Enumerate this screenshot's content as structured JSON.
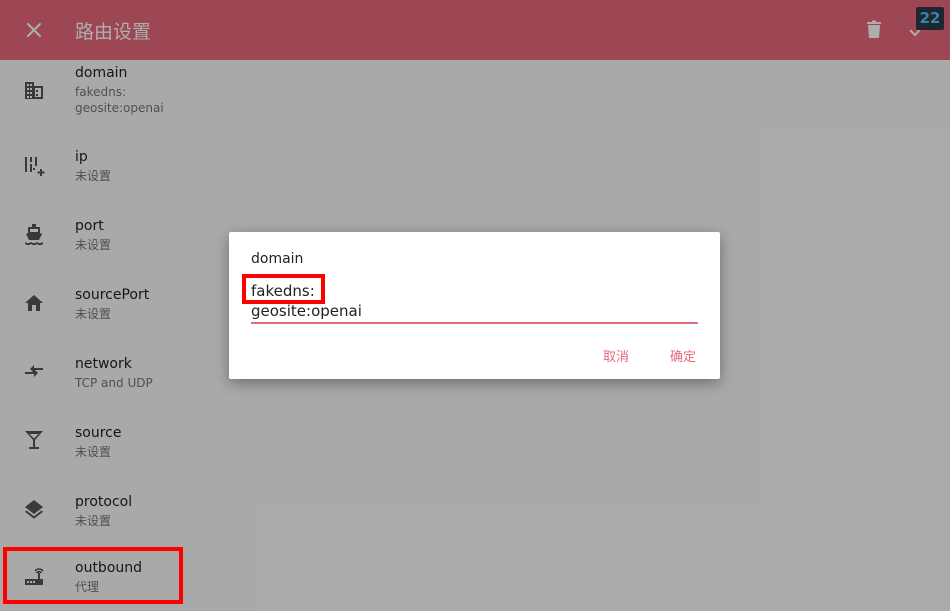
{
  "appbar": {
    "title": "路由设置",
    "badge": "22",
    "color": "#e8687c"
  },
  "rows": [
    {
      "name": "domain",
      "value_lines": [
        "fakedns:",
        "geosite:openai"
      ],
      "icon": "domain-icon"
    },
    {
      "name": "ip",
      "value": "未设置",
      "icon": "dialpad-plus-icon"
    },
    {
      "name": "port",
      "value": "未设置",
      "icon": "ship-icon"
    },
    {
      "name": "sourcePort",
      "value": "未设置",
      "icon": "home-icon"
    },
    {
      "name": "network",
      "value": "TCP and UDP",
      "icon": "swap-arrows-icon"
    },
    {
      "name": "source",
      "value": "未设置",
      "icon": "cocktail-icon"
    },
    {
      "name": "protocol",
      "value": "未设置",
      "icon": "layers-icon"
    },
    {
      "name": "outbound",
      "value": "代理",
      "icon": "router-icon"
    }
  ],
  "dialog": {
    "title": "domain",
    "input_lines": [
      "fakedns:",
      "geosite:openai"
    ],
    "cancel_label": "取消",
    "ok_label": "确定"
  }
}
